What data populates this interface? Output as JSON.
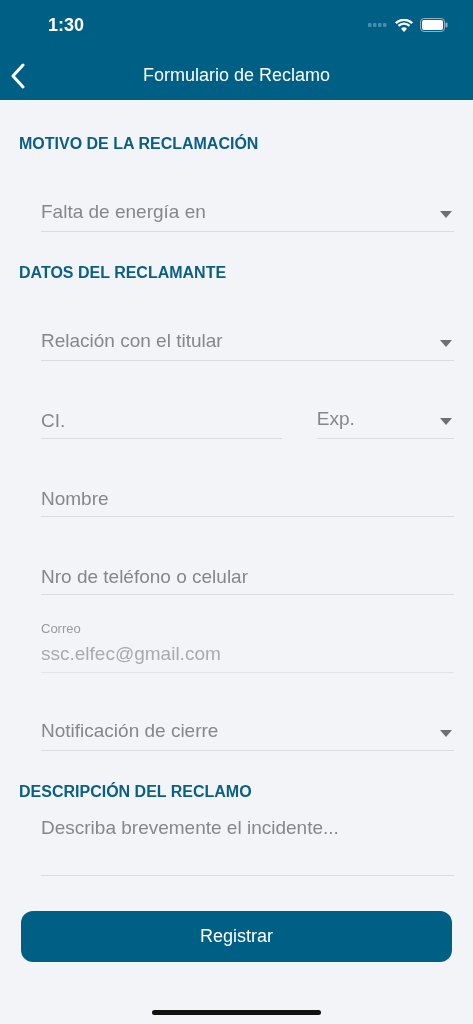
{
  "status_bar": {
    "time": "1:30"
  },
  "nav_bar": {
    "title": "Formulario de Reclamo"
  },
  "sections": [
    {
      "title": "MOTIVO DE LA RECLAMACIÓN",
      "fields": [
        {
          "kind": "select",
          "placeholder": "Falta de energía en"
        }
      ]
    },
    {
      "title": "DATOS DEL RECLAMANTE",
      "fields": [
        {
          "kind": "select",
          "placeholder": "Relación con el titular"
        },
        {
          "kind": "pair",
          "items": [
            {
              "kind": "text",
              "placeholder": "CI.",
              "disabled": false
            },
            {
              "kind": "select",
              "placeholder": "Exp."
            }
          ]
        },
        {
          "kind": "text",
          "placeholder": "Nombre",
          "disabled": false
        },
        {
          "kind": "text",
          "placeholder": "Nro de teléfono o celular",
          "disabled": false
        },
        {
          "kind": "text",
          "label": "Correo",
          "value": "ssc.elfec@gmail.com",
          "disabled": true
        },
        {
          "kind": "select",
          "placeholder": "Notificación de cierre"
        }
      ]
    },
    {
      "title": "DESCRIPCIÓN DEL RECLAMO",
      "fields": [
        {
          "kind": "textarea",
          "placeholder": "Describa brevemente el incidente..."
        }
      ]
    }
  ],
  "submit_button": {
    "label": "Registrar"
  }
}
